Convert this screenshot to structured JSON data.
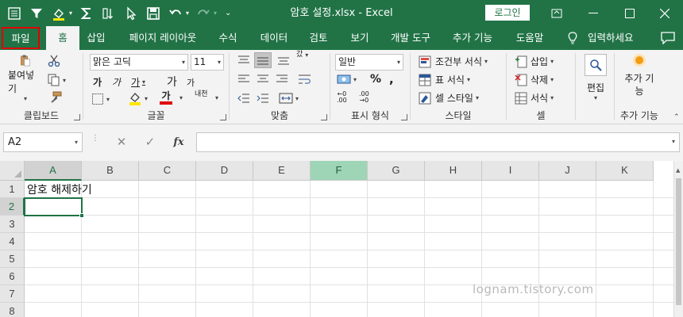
{
  "window": {
    "title": "암호 설정.xlsx  -  Excel",
    "login_label": "로그인"
  },
  "tabs": {
    "file": "파일",
    "home": "홈",
    "insert": "삽입",
    "page_layout": "페이지 레이아웃",
    "formulas": "수식",
    "data": "데이터",
    "review": "검토",
    "view": "보기",
    "developer": "개발 도구",
    "addins": "추가 기능",
    "help": "도움말",
    "tell_me": "입력하세요"
  },
  "ribbon": {
    "clipboard": {
      "label": "클립보드",
      "paste": "붙여넣기"
    },
    "font": {
      "label": "글꼴",
      "font_name": "맑은 고딕",
      "font_size": "11",
      "bold": "가",
      "italic": "가",
      "underline": "가",
      "grow": "가",
      "shrink": "가",
      "color_glyph": "가",
      "phonetic": "내천"
    },
    "alignment": {
      "label": "맞춤",
      "wrap_glyph": "갔"
    },
    "number": {
      "label": "표시 형식",
      "format": "일반"
    },
    "styles": {
      "label": "스타일",
      "conditional": "조건부 서식",
      "table": "표 서식",
      "cell": "셀 스타일"
    },
    "cells": {
      "label": "셀",
      "insert": "삽입",
      "delete": "삭제",
      "format": "서식"
    },
    "editing": {
      "label": "편집"
    },
    "addins": {
      "label": "추가 기능",
      "button": "추가 기능"
    }
  },
  "formula_bar": {
    "name_box": "A2",
    "fx": "fx",
    "content": ""
  },
  "sheet": {
    "columns": [
      "A",
      "B",
      "C",
      "D",
      "E",
      "F",
      "G",
      "H",
      "I",
      "J",
      "K"
    ],
    "rows": [
      "1",
      "2",
      "3",
      "4",
      "5",
      "6",
      "7",
      "8"
    ],
    "a1": "암호 해제하기",
    "active_cell": "A2",
    "highlighted_column": "F"
  },
  "watermark": "lognam.tistory.com",
  "colors": {
    "accent": "#217346",
    "file_tab_outline": "#e00000"
  }
}
